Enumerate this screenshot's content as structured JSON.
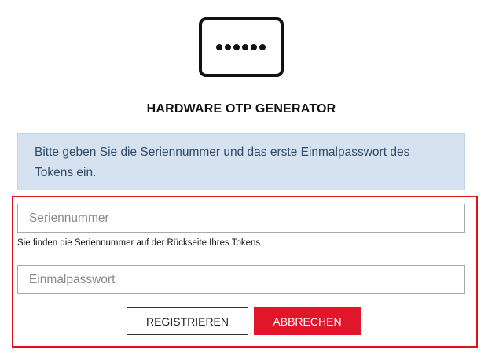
{
  "header": {
    "icon": "otp-token-icon",
    "title": "HARDWARE OTP GENERATOR"
  },
  "info": {
    "text": "Bitte geben Sie die Seriennummer und das erste Einmalpasswort des Tokens ein."
  },
  "form": {
    "serial": {
      "placeholder": "Seriennummer",
      "value": "",
      "hint": "Sie finden die Seriennummer auf der Rückseite Ihres Tokens."
    },
    "otp": {
      "placeholder": "Einmalpasswort",
      "value": ""
    },
    "register_label": "REGISTRIEREN",
    "cancel_label": "ABBRECHEN"
  },
  "colors": {
    "accent": "#e0172a",
    "frame_border": "#d9141e",
    "info_background": "#d6e2f0",
    "info_text": "#2e4a66"
  }
}
